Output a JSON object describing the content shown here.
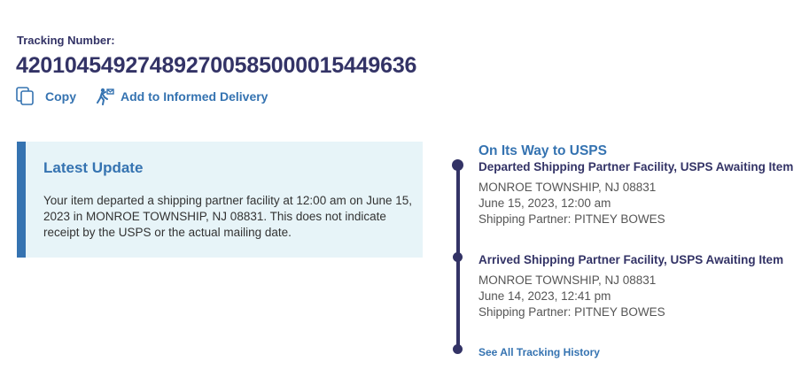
{
  "tracking": {
    "label": "Tracking Number:",
    "number": "420104549274892700585000015449636"
  },
  "actions": {
    "copy_label": "Copy",
    "informed_label": "Add to Informed Delivery"
  },
  "latest_update": {
    "title": "Latest Update",
    "body": "Your item departed a shipping partner facility at 12:00 am on June 15, 2023 in MONROE TOWNSHIP, NJ 08831. This does not indicate receipt by the USPS or the actual mailing date."
  },
  "timeline": {
    "status": "On Its Way to USPS",
    "events": [
      {
        "title": "Departed Shipping Partner Facility, USPS Awaiting Item",
        "location": "MONROE TOWNSHIP, NJ 08831",
        "datetime": "June 15, 2023, 12:00 am",
        "partner": "Shipping Partner: PITNEY BOWES"
      },
      {
        "title": "Arrived Shipping Partner Facility, USPS Awaiting Item",
        "location": "MONROE TOWNSHIP, NJ 08831",
        "datetime": "June 14, 2023, 12:41 pm",
        "partner": "Shipping Partner: PITNEY BOWES"
      }
    ],
    "history_link": "See All Tracking History"
  },
  "icons": {
    "copy": "copy-icon",
    "informed": "informed-delivery-icon"
  },
  "colors": {
    "navy": "#333366",
    "link_blue": "#3573b1",
    "panel_bg": "#e7f4f8"
  }
}
